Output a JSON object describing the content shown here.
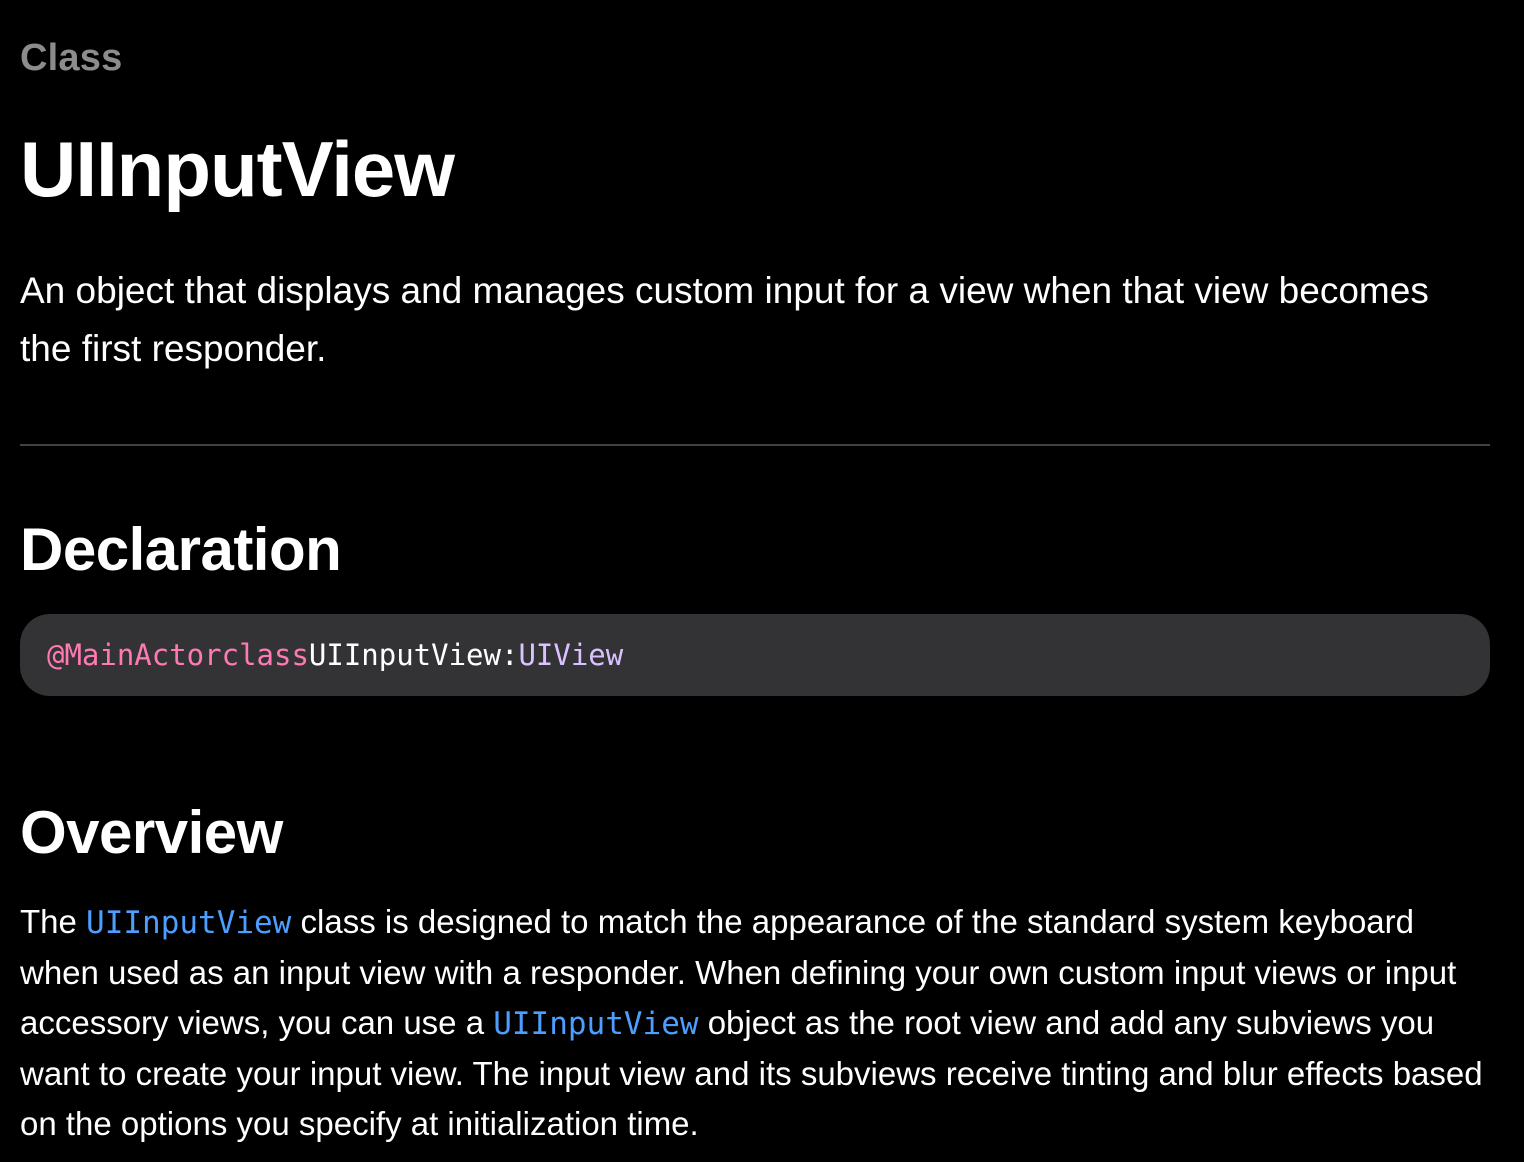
{
  "header": {
    "eyebrow": "Class",
    "title": "UIInputView",
    "abstract": "An object that displays and manages custom input for a view when that view becomes the first responder."
  },
  "declaration": {
    "heading": "Declaration",
    "code": {
      "attribute": "@MainActor",
      "keyword": "class",
      "name": "UIInputView",
      "separator": ":",
      "superclass": "UIView"
    }
  },
  "overview": {
    "heading": "Overview",
    "text_1": "The ",
    "link_1": "UIInputView",
    "text_2": " class is designed to match the appearance of the standard system keyboard when used as an input view with a responder. When defining your own custom input views or input accessory views, you can use a ",
    "link_2": "UIInputView",
    "text_3": " object as the root view and add any subviews you want to create your input view. The input view and its subviews receive tinting and blur effects based on the options you specify at initialization time."
  },
  "colors": {
    "background": "#000000",
    "eyebrow": "#8c8c8c",
    "code_background": "#333336",
    "code_keyword": "#ff7ab2",
    "code_type": "#d9c2ff",
    "link": "#4c9eff",
    "divider": "#424245"
  }
}
